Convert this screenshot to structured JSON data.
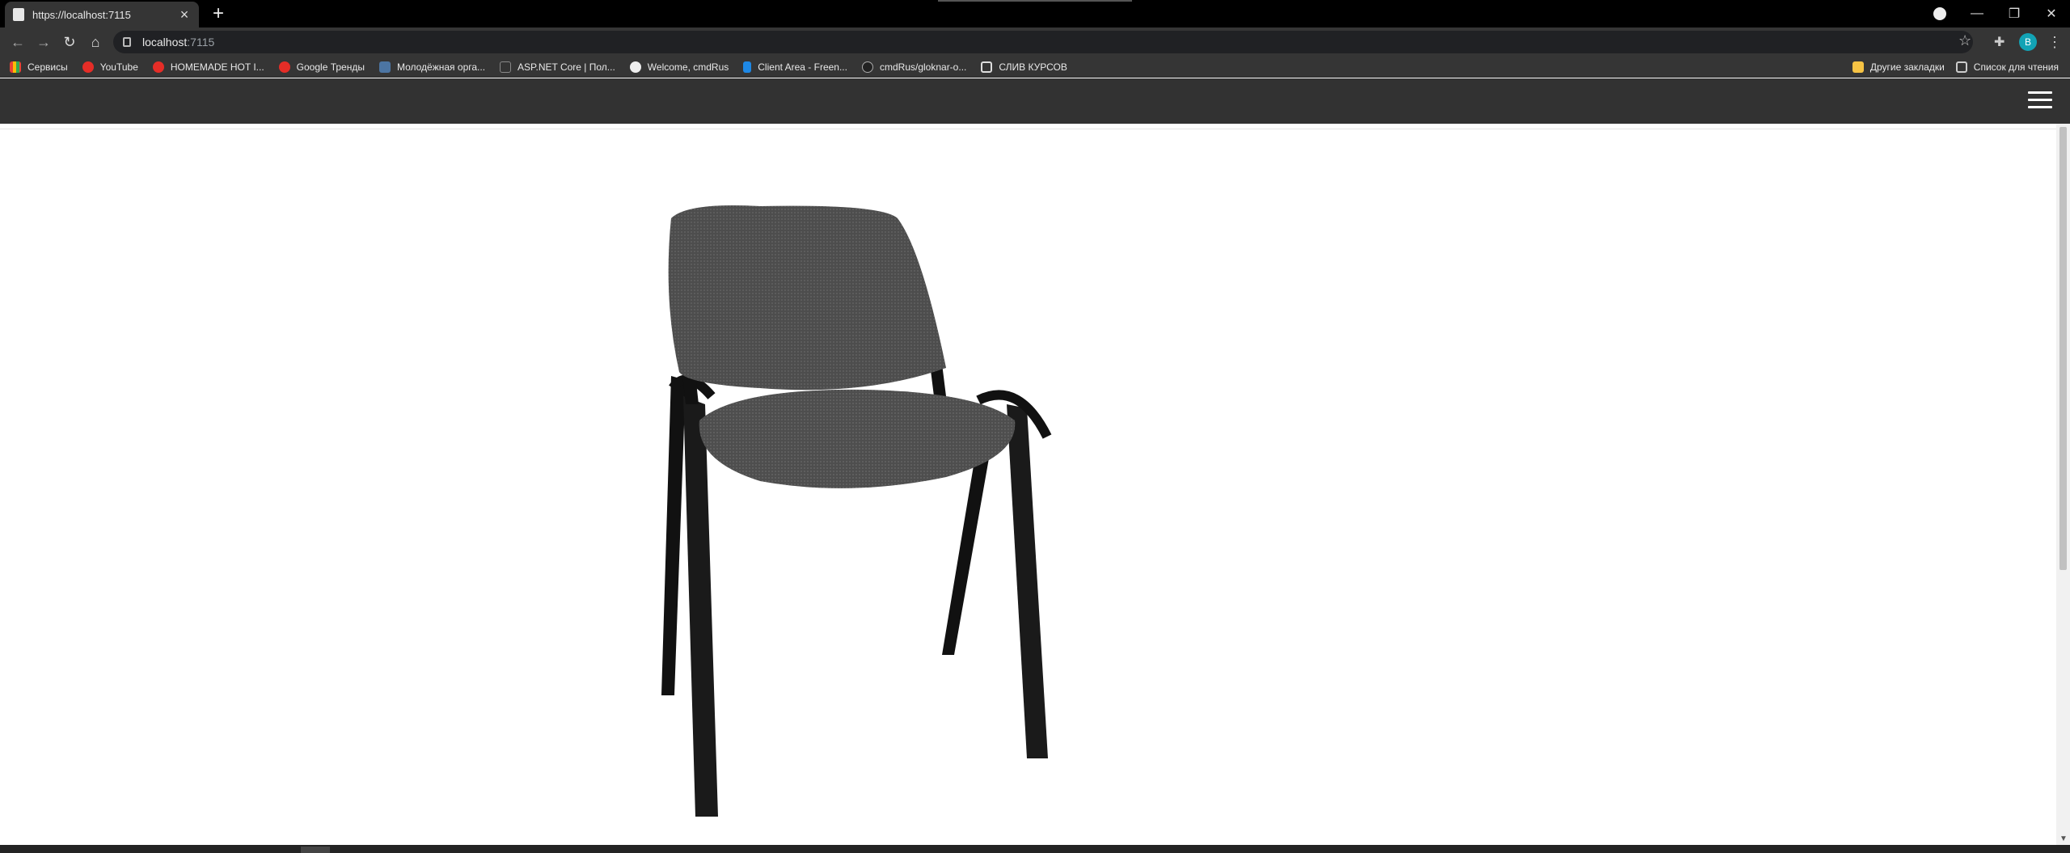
{
  "browser": {
    "tab_title": "https://localhost:7115",
    "tab_close": "×",
    "new_tab": "+",
    "window_controls": {
      "minimize": "—",
      "restore": "❐",
      "close": "✕"
    },
    "address_host": "localhost",
    "address_port": ":7115",
    "nav": {
      "back": "←",
      "forward": "→",
      "reload": "↻",
      "home": "⌂"
    },
    "star": "☆",
    "extensions": "✚",
    "profile_initial": "B",
    "menu": "⋮"
  },
  "bookmarks": [
    {
      "label": "Сервисы",
      "icon": "apps-grid-icon"
    },
    {
      "label": "YouTube",
      "icon": "youtube-icon"
    },
    {
      "label": "HOMEMADE HOT I...",
      "icon": "youtube-icon"
    },
    {
      "label": "Google Тренды",
      "icon": "youtube-icon"
    },
    {
      "label": "Молодёжная орга...",
      "icon": "vk-icon"
    },
    {
      "label": "ASP.NET Core | Пол...",
      "icon": "document-icon"
    },
    {
      "label": "Welcome, cmdRus",
      "icon": "globe-icon"
    },
    {
      "label": "Client Area - Freen...",
      "icon": "freenom-icon"
    },
    {
      "label": "cmdRus/gloknar-o...",
      "icon": "github-icon"
    },
    {
      "label": "СЛИВ КУРСОВ",
      "icon": "square-icon"
    }
  ],
  "bookmarks_right": {
    "other": "Другие закладки",
    "reading_list": "Список для чтения"
  },
  "page": {
    "image_subject": "chair"
  },
  "colors": {
    "tab_strip": "#000000",
    "toolbar": "#353535",
    "app_bar": "#323232",
    "avatar": "#12a3b5"
  }
}
